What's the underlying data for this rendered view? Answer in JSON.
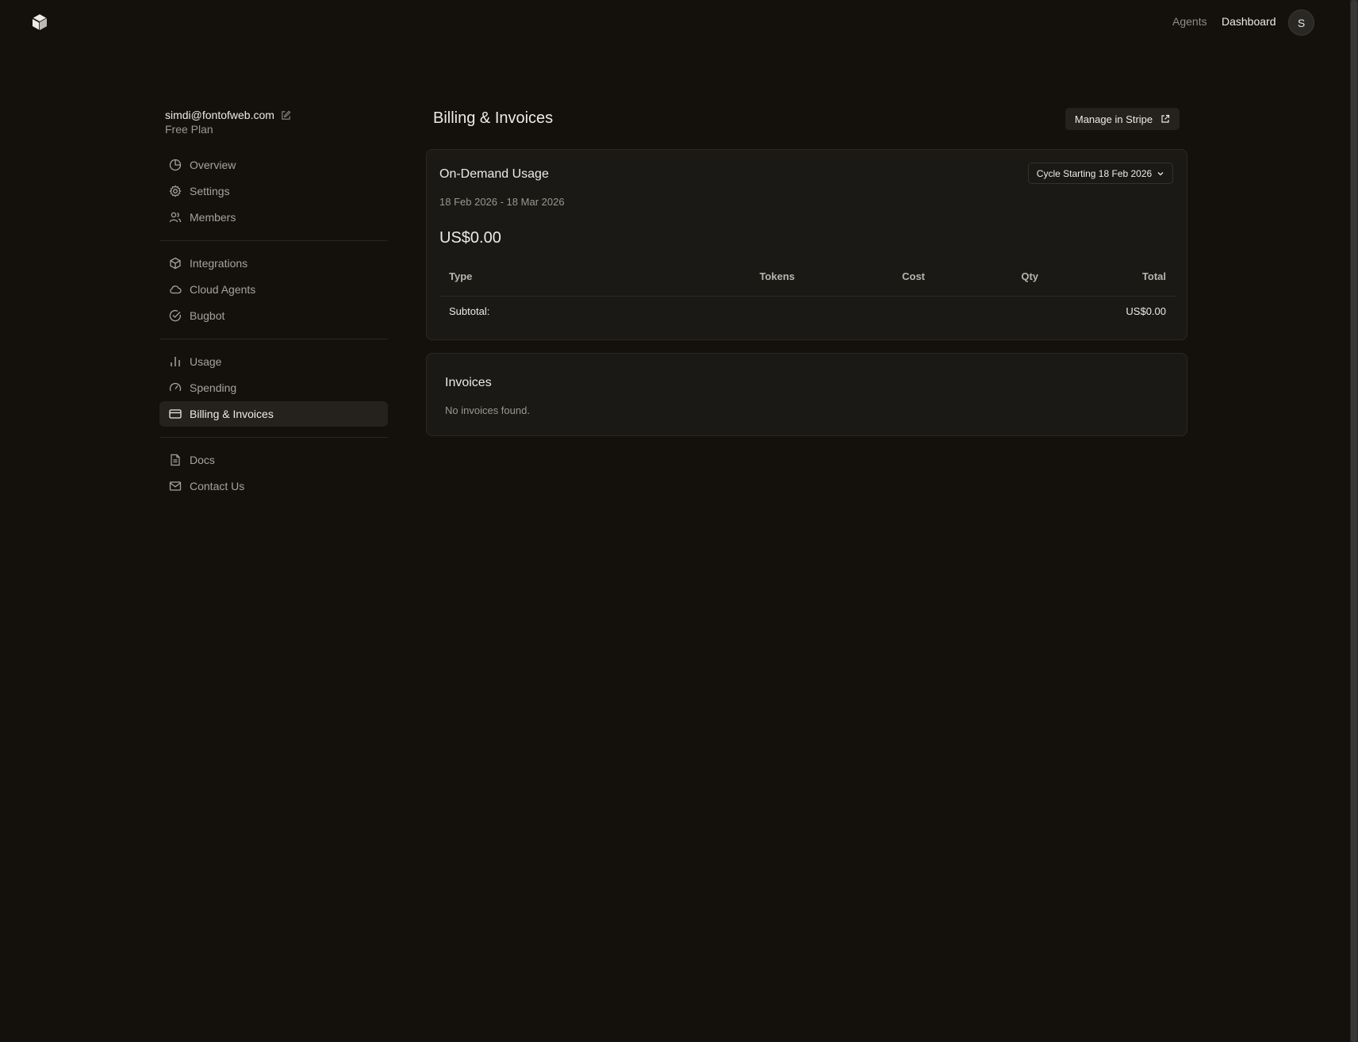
{
  "header": {
    "nav": [
      "Agents",
      "Dashboard"
    ],
    "avatar_initial": "S"
  },
  "account": {
    "email": "simdi@fontofweb.com",
    "plan": "Free Plan"
  },
  "sidebar": {
    "items": [
      {
        "label": "Overview",
        "icon": "pie-chart-icon"
      },
      {
        "label": "Settings",
        "icon": "gear-icon"
      },
      {
        "label": "Members",
        "icon": "users-icon"
      },
      {
        "label": "Integrations",
        "icon": "cube-icon"
      },
      {
        "label": "Cloud Agents",
        "icon": "cloud-icon"
      },
      {
        "label": "Bugbot",
        "icon": "check-circle-icon"
      },
      {
        "label": "Usage",
        "icon": "bar-chart-icon"
      },
      {
        "label": "Spending",
        "icon": "gauge-icon"
      },
      {
        "label": "Billing & Invoices",
        "icon": "credit-card-icon",
        "active": true
      },
      {
        "label": "Docs",
        "icon": "document-icon"
      },
      {
        "label": "Contact Us",
        "icon": "mail-icon"
      }
    ]
  },
  "main": {
    "title": "Billing & Invoices",
    "manage_button": "Manage in Stripe",
    "usage": {
      "title": "On-Demand Usage",
      "cycle_select": "Cycle Starting 18 Feb 2026",
      "date_range": "18 Feb 2026 - 18 Mar 2026",
      "total": "US$0.00",
      "columns": [
        "Type",
        "Tokens",
        "Cost",
        "Qty",
        "Total"
      ],
      "subtotal_label": "Subtotal:",
      "subtotal_value": "US$0.00"
    },
    "invoices": {
      "title": "Invoices",
      "empty_text": "No invoices found."
    }
  },
  "colors": {
    "background": "#14110c",
    "card": "#1b1915",
    "active_nav": "#25221d"
  }
}
